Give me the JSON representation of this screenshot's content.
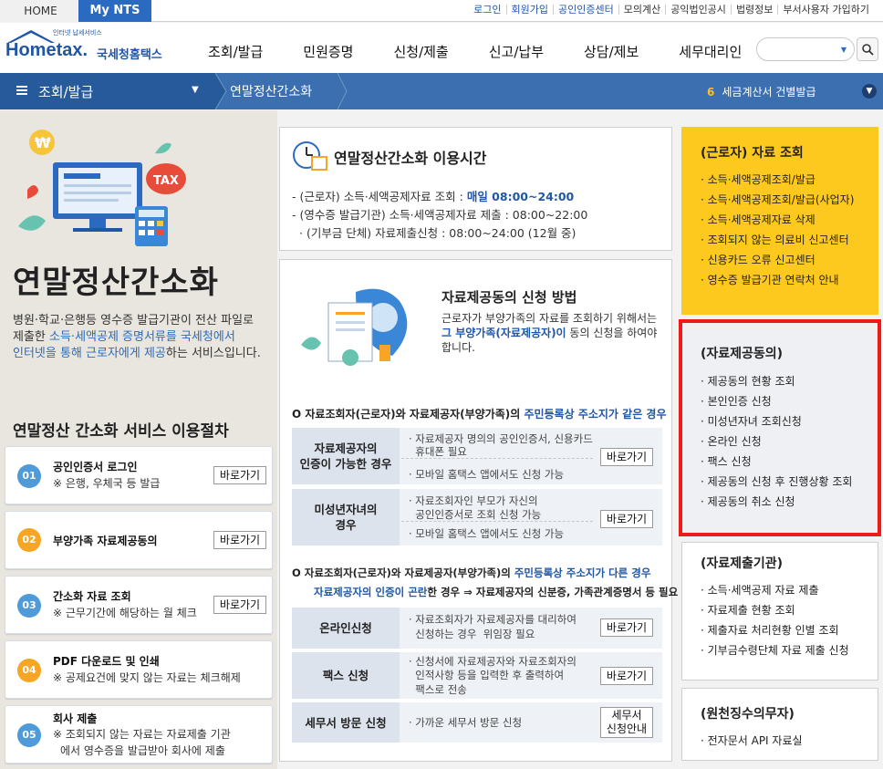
{
  "topbar": {
    "home": "HOME",
    "mynts": "My NTS",
    "links": [
      "로그인",
      "회원가입",
      "공인인증센터",
      "모의계산",
      "공익법인공시",
      "법령정보",
      "부서사용자 가입하기"
    ]
  },
  "header": {
    "logo_small": "인터넷 납세서비스",
    "logo_main": "Hometax.",
    "logo_kr": "국세청홈택스",
    "menu": [
      "조회/발급",
      "민원증명",
      "신청/제출",
      "신고/납부",
      "상담/제보",
      "세무대리인"
    ]
  },
  "nav": {
    "title": "조회/발급",
    "sub": "연말정산간소화",
    "notice_num": "6",
    "notice_text": "세금계산서 건별발급"
  },
  "left": {
    "hero_title": "연말정산간소화",
    "desc1": "병원·학교·은행등 영수증 발급기관이 전산 파일로",
    "desc2_pre": "제출한 ",
    "desc2_hl": "소득·세액공제 증명서류를 국세청에서",
    "desc3_hl": "인터넷을 통해 근로자에게 제공",
    "desc3_post": "하는 서비스입니다.",
    "proc_title": "연말정산 간소화 서비스 이용절차",
    "steps": [
      {
        "num": "01",
        "title": "공인인증서 로그인",
        "sub1": "※ 은행, 우체국 등 발급",
        "sub2": "",
        "btn": "바로가기"
      },
      {
        "num": "02",
        "title": "부양가족 자료제공동의",
        "sub1": "",
        "sub2": "",
        "btn": "바로가기"
      },
      {
        "num": "03",
        "title": "간소화 자료 조회",
        "sub1": "※ 근무기간에 해당하는 월 체크",
        "sub2": "",
        "btn": "바로가기"
      },
      {
        "num": "04",
        "title": "PDF 다운로드 및 인쇄",
        "sub1": "※ 공제요건에 맞지 않는 자료는 체크해제",
        "sub2": "",
        "btn": ""
      },
      {
        "num": "05",
        "title": "회사 제출",
        "sub1": "※ 조회되지 않는 자료는 자료제출 기관",
        "sub2": "에서 영수증을 발급받아 회사에 제출",
        "btn": ""
      }
    ]
  },
  "time": {
    "title": "연말정산간소화 이용시간",
    "l1_pre": "- (근로자) 소득·세액공제자료 조회 : ",
    "l1_hl": "매일 08:00~24:00",
    "l2": "- (영수증 발급기관) 소득·세액공제자료 제출 : 08:00~22:00",
    "l3": "· (기부금 단체) 자료제출신청 : 08:00~24:00 (12월 중)"
  },
  "apply": {
    "title": "자료제공동의 신청 방법",
    "desc1": "근로자가 부양가족의 자료를 조회하기 위해서는",
    "desc2_hl": "그 부양가족(자료제공자)이",
    "desc2_post": " 동의 신청을 하여야",
    "desc3": "합니다.",
    "sec1_pre": "O 자료조회자(근로자)와 자료제공자(부양가족)의 ",
    "sec1_hl": "주민등록상 주소지가 같은 경우",
    "rows1": [
      {
        "head1": "자료제공자의",
        "head2": "인증이 가능한 경우",
        "d1": "· 자료제공자 명의의 공인인증서, 신용카드",
        "d2": "  휴대폰 필요",
        "d3": "· 모바일 홈택스 앱에서도 신청 가능",
        "btn": "바로가기"
      },
      {
        "head1": "미성년자녀의",
        "head2": "경우",
        "d1": "· 자료조회자인 부모가 자신의",
        "d2": "  공인인증서로 조회 신청 가능",
        "d3": "· 모바일 홈택스 앱에서도 신청 가능",
        "btn": "바로가기"
      }
    ],
    "sec2a_pre": "자료조회자(근로자)와 자료제공자(부양가족)의 ",
    "sec2a_hl": "주민등록상 주소지가 다른 경우",
    "sec2b_hl": "자료제공자의 인증이 곤란",
    "sec2b_post": "한 경우 ⇒ 자료제공자의 신분증, 가족관계증명서 등 필요",
    "rows2": [
      {
        "head": "온라인신청",
        "d1": "· 자료조회자가 자료제공자를 대리하여",
        "d2": "  신청하는 경우  위임장 필요",
        "d3": "",
        "btn": "바로가기"
      },
      {
        "head": "팩스 신청",
        "d1": "· 신청서에 자료제공자와 자료조회자의",
        "d2": "  인적사항 등을 입력한 후 출력하여",
        "d3": "  팩스로 전송",
        "btn": "바로가기"
      },
      {
        "head": "세무서 방문 신청",
        "d1": "· 가까운 세무서 방문 신청",
        "d2": "",
        "d3": "",
        "btn1": "세무서",
        "btn2": "신청안내"
      }
    ]
  },
  "right": {
    "box1": {
      "title": "(근로자) 자료 조회",
      "items": [
        "소득·세액공제조회/발급",
        "소득·세액공제조회/발급(사업자)",
        "소득·세액공제자료 삭제",
        "조회되지 않는 의료비 신고센터",
        "신용카드 오류 신고센터",
        "영수증 발급기관 연락처 안내"
      ]
    },
    "box2": {
      "title": "(자료제공동의)",
      "items": [
        "제공동의 현황 조회",
        "본인인증 신청",
        "미성년자녀 조회신청",
        "온라인 신청",
        "팩스 신청",
        "제공동의 신청 후 진행상황 조회",
        "제공동의 취소 신청"
      ]
    },
    "box3": {
      "title": "(자료제출기관)",
      "items": [
        "소득·세액공제 자료 제출",
        "자료제출 현황 조회",
        "제출자료 처리현황 인별 조회",
        "기부금수령단체 자료 제출 신청"
      ]
    },
    "box4": {
      "title": "(원천징수의무자)",
      "items": [
        "전자문서 API 자료실"
      ]
    }
  },
  "colors": {
    "brand": "#2a6bc1",
    "nav": "#3b6fb0",
    "highlight": "#ee1a1a",
    "yellow": "#fdc91e"
  }
}
